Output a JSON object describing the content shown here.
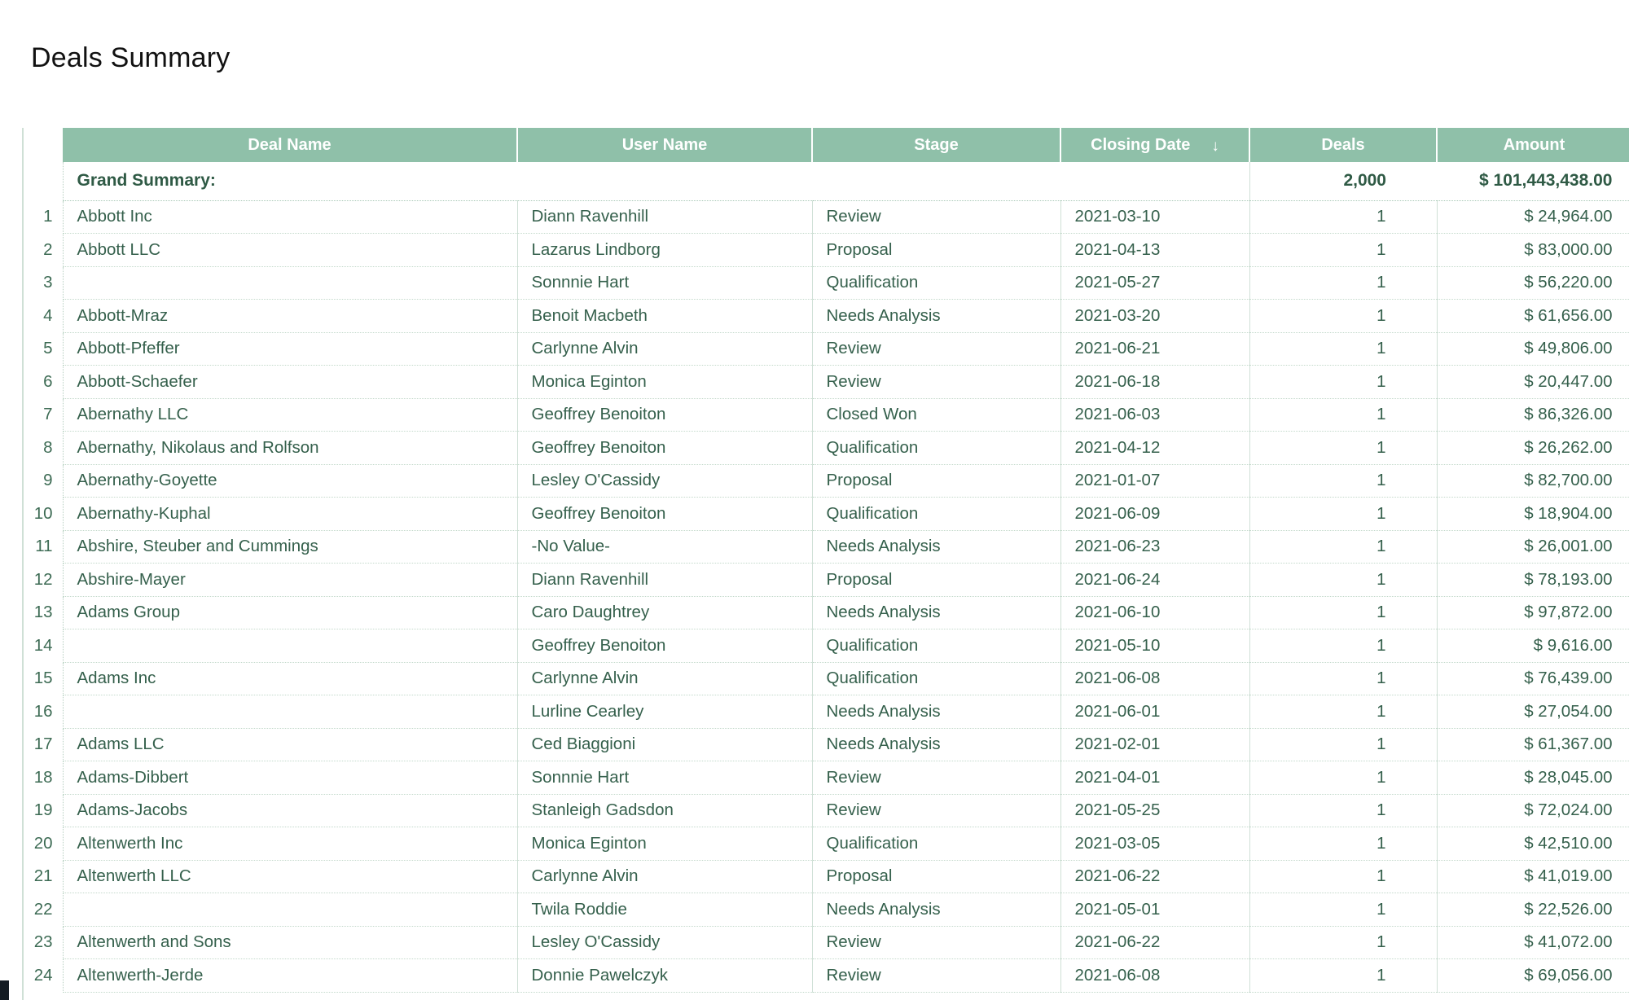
{
  "page": {
    "title": "Deals Summary"
  },
  "table": {
    "columns": [
      {
        "key": "index",
        "label": ""
      },
      {
        "key": "deal",
        "label": "Deal Name"
      },
      {
        "key": "user",
        "label": "User Name"
      },
      {
        "key": "stage",
        "label": "Stage"
      },
      {
        "key": "date",
        "label": "Closing Date",
        "sort": "descending",
        "sort_glyph": "↓"
      },
      {
        "key": "deals",
        "label": "Deals"
      },
      {
        "key": "amount",
        "label": "Amount"
      }
    ],
    "summary": {
      "label": "Grand Summary:",
      "deals": "2,000",
      "amount": "$ 101,443,438.00"
    },
    "header_background": "#8fc0a9",
    "text_color": "#35604c",
    "rows": [
      {
        "index": "1",
        "deal": "Abbott Inc",
        "user": "Diann Ravenhill",
        "stage": "Review",
        "date": "2021-03-10",
        "deals": "1",
        "amount": "$ 24,964.00"
      },
      {
        "index": "2",
        "deal": "Abbott LLC",
        "user": "Lazarus Lindborg",
        "stage": "Proposal",
        "date": "2021-04-13",
        "deals": "1",
        "amount": "$ 83,000.00"
      },
      {
        "index": "3",
        "deal": "",
        "user": "Sonnnie Hart",
        "stage": "Qualification",
        "date": "2021-05-27",
        "deals": "1",
        "amount": "$ 56,220.00"
      },
      {
        "index": "4",
        "deal": "Abbott-Mraz",
        "user": "Benoit Macbeth",
        "stage": "Needs Analysis",
        "date": "2021-03-20",
        "deals": "1",
        "amount": "$ 61,656.00"
      },
      {
        "index": "5",
        "deal": "Abbott-Pfeffer",
        "user": "Carlynne Alvin",
        "stage": "Review",
        "date": "2021-06-21",
        "deals": "1",
        "amount": "$ 49,806.00"
      },
      {
        "index": "6",
        "deal": "Abbott-Schaefer",
        "user": "Monica Eginton",
        "stage": "Review",
        "date": "2021-06-18",
        "deals": "1",
        "amount": "$ 20,447.00"
      },
      {
        "index": "7",
        "deal": "Abernathy LLC",
        "user": "Geoffrey Benoiton",
        "stage": "Closed Won",
        "date": "2021-06-03",
        "deals": "1",
        "amount": "$ 86,326.00"
      },
      {
        "index": "8",
        "deal": "Abernathy, Nikolaus and Rolfson",
        "user": "Geoffrey Benoiton",
        "stage": "Qualification",
        "date": "2021-04-12",
        "deals": "1",
        "amount": "$ 26,262.00"
      },
      {
        "index": "9",
        "deal": "Abernathy-Goyette",
        "user": "Lesley O'Cassidy",
        "stage": "Proposal",
        "date": "2021-01-07",
        "deals": "1",
        "amount": "$ 82,700.00"
      },
      {
        "index": "10",
        "deal": "Abernathy-Kuphal",
        "user": "Geoffrey Benoiton",
        "stage": "Qualification",
        "date": "2021-06-09",
        "deals": "1",
        "amount": "$ 18,904.00"
      },
      {
        "index": "11",
        "deal": "Abshire, Steuber and Cummings",
        "user": "-No Value-",
        "stage": "Needs Analysis",
        "date": "2021-06-23",
        "deals": "1",
        "amount": "$ 26,001.00"
      },
      {
        "index": "12",
        "deal": "Abshire-Mayer",
        "user": "Diann Ravenhill",
        "stage": "Proposal",
        "date": "2021-06-24",
        "deals": "1",
        "amount": "$ 78,193.00"
      },
      {
        "index": "13",
        "deal": "Adams Group",
        "user": "Caro Daughtrey",
        "stage": "Needs Analysis",
        "date": "2021-06-10",
        "deals": "1",
        "amount": "$ 97,872.00"
      },
      {
        "index": "14",
        "deal": "",
        "user": "Geoffrey Benoiton",
        "stage": "Qualification",
        "date": "2021-05-10",
        "deals": "1",
        "amount": "$ 9,616.00"
      },
      {
        "index": "15",
        "deal": "Adams Inc",
        "user": "Carlynne Alvin",
        "stage": "Qualification",
        "date": "2021-06-08",
        "deals": "1",
        "amount": "$ 76,439.00"
      },
      {
        "index": "16",
        "deal": "",
        "user": "Lurline Cearley",
        "stage": "Needs Analysis",
        "date": "2021-06-01",
        "deals": "1",
        "amount": "$ 27,054.00"
      },
      {
        "index": "17",
        "deal": "Adams LLC",
        "user": "Ced Biaggioni",
        "stage": "Needs Analysis",
        "date": "2021-02-01",
        "deals": "1",
        "amount": "$ 61,367.00"
      },
      {
        "index": "18",
        "deal": "Adams-Dibbert",
        "user": "Sonnnie Hart",
        "stage": "Review",
        "date": "2021-04-01",
        "deals": "1",
        "amount": "$ 28,045.00"
      },
      {
        "index": "19",
        "deal": "Adams-Jacobs",
        "user": "Stanleigh Gadsdon",
        "stage": "Review",
        "date": "2021-05-25",
        "deals": "1",
        "amount": "$ 72,024.00"
      },
      {
        "index": "20",
        "deal": "Altenwerth Inc",
        "user": "Monica Eginton",
        "stage": "Qualification",
        "date": "2021-03-05",
        "deals": "1",
        "amount": "$ 42,510.00"
      },
      {
        "index": "21",
        "deal": "Altenwerth LLC",
        "user": "Carlynne Alvin",
        "stage": "Proposal",
        "date": "2021-06-22",
        "deals": "1",
        "amount": "$ 41,019.00"
      },
      {
        "index": "22",
        "deal": "",
        "user": "Twila Roddie",
        "stage": "Needs Analysis",
        "date": "2021-05-01",
        "deals": "1",
        "amount": "$ 22,526.00"
      },
      {
        "index": "23",
        "deal": "Altenwerth and Sons",
        "user": "Lesley O'Cassidy",
        "stage": "Review",
        "date": "2021-06-22",
        "deals": "1",
        "amount": "$ 41,072.00"
      },
      {
        "index": "24",
        "deal": "Altenwerth-Jerde",
        "user": "Donnie Pawelczyk",
        "stage": "Review",
        "date": "2021-06-08",
        "deals": "1",
        "amount": "$ 69,056.00"
      }
    ]
  }
}
